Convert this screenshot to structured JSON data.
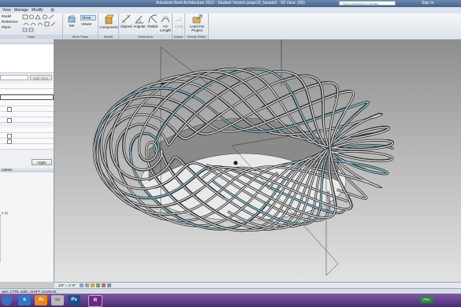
{
  "window": {
    "title": "Autodesk Revit Architecture 2012 - Student Version      project2_facade2 - 3D View: {3D}",
    "search_placeholder": "Type a keyword or phrase",
    "sign_in": "Sign In"
  },
  "menu": {
    "items": [
      "View",
      "Manage",
      "Modify"
    ]
  },
  "ribbon": {
    "draw": {
      "label": "Draw",
      "items": [
        "Model",
        "Reference",
        "Plane"
      ]
    },
    "work_plane": {
      "label": "Work Plane",
      "set": "Set",
      "show": "Show",
      "viewer": "Viewer"
    },
    "model": {
      "label": "Model",
      "component": "Component"
    },
    "dimension": {
      "label": "Dimension",
      "aligned": "Aligned",
      "angular": "Angular",
      "radial": "Radial",
      "arc_length": "Arc Length"
    },
    "datum": {
      "label": "Datum",
      "level": "Level"
    },
    "family_editor": {
      "label": "Family Editor",
      "load": "Load into Project"
    }
  },
  "properties_panel": {
    "edit_type": "Edit Type",
    "apply": "Apply"
  },
  "browser_panel": {
    "title": "rowser",
    "item": "n 1)"
  },
  "view_control": {
    "scale": "1/2\" = 1'-0\""
  },
  "status": {
    "text": "ates, CTRL adds, SHIFT unselects."
  },
  "taskbar": {
    "battery": "76%",
    "time": "",
    "apps": [
      "ie",
      "ai",
      "ps",
      "pr",
      "revit"
    ]
  },
  "colors": {
    "title_bar": "#44628a",
    "taskbar": "#4c2d76",
    "ribbon_highlight": "#cfe3f7"
  }
}
